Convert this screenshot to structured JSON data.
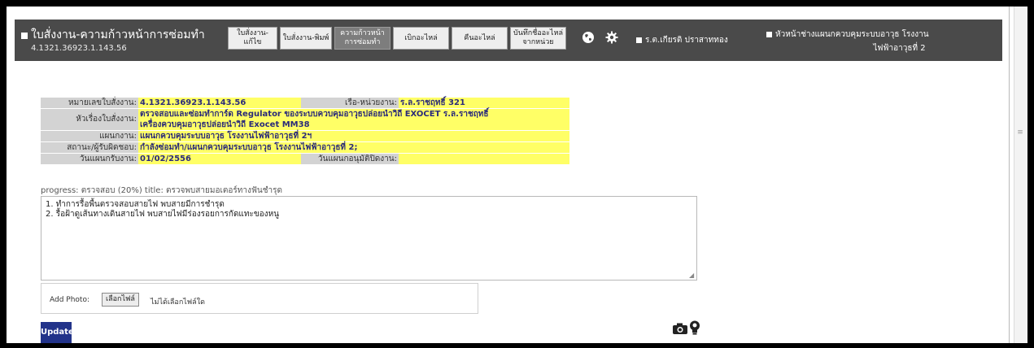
{
  "header": {
    "title": "ใบสั่งงาน-ความก้าวหน้าการซ่อมทำ",
    "subtitle": "4.1321.36923.1.143.56",
    "menu": [
      {
        "label": "ใบสั่งงาน-แก้ไข"
      },
      {
        "label": "ใบสั่งงาน-พิมพ์"
      },
      {
        "label": "ความก้าวหน้า การซ่อมทำ"
      },
      {
        "label": "เบิกอะไหล่"
      },
      {
        "label": "คืนอะไหล่"
      },
      {
        "label": "บันทึกชื่ออะไหล่ จากหน่วย"
      }
    ],
    "icons": [
      "globe-icon",
      "gear-icon"
    ],
    "links": [
      {
        "label": "ร.ต.เกียรติ ปราสาททอง"
      },
      {
        "label": "หัวหน้าช่างแผนกควบคุมระบบอาวุธ โรงงานไฟฟ้าอาวุธที่ 2"
      }
    ],
    "link2_line1": "หัวหน้าช่างแผนกควบคุมระบบอาวุธ โรงงาน",
    "link2_line2": "ไฟฟ้าอาวุธที่ 2"
  },
  "info": {
    "work_order_no_label": "หมายเลขใบสั่งงาน:",
    "work_order_no": "4.1321.36923.1.143.56",
    "ship_label": "เรือ-หน่วยงาน:",
    "ship": "ร.ล.ราชฤทธิ์ 321",
    "subject_label": "หัวเรื่องใบสั่งงาน:",
    "subject_line1": "ตรวจสอบและซ่อมทำการ์ด Regulator ของระบบควบคุมอาวุธปล่อยนำวิถี EXOCET ร.ล.ราชฤทธิ์",
    "subject_line2": "เครื่องควบคุมอาวุธปล่อยนำวิถี Exocet MM38",
    "dept_label": "แผนกงาน:",
    "dept": "แผนกควบคุมระบบอาวุธ โรงงานไฟฟ้าอาวุธที่ 2ฯ",
    "status_label": "สถานะ/ผู้รับผิดชอบ:",
    "status": "กำลังซ่อมทำ/แผนกควบคุมระบบอาวุธ โรงงานไฟฟ้าอาวุธที่ 2;",
    "received_date_label": "วันแผนกรับงาน:",
    "received_date": "01/02/2556",
    "approve_date_label": "วันแผนกอนุมัติปิดงาน:",
    "approve_date": ""
  },
  "progress": {
    "text": "progress: ตรวจสอบ (20%) title: ตรวจพบสายมอเตอร์ทางฟันชำรุด",
    "percent": 20,
    "notes": "1. ทำการรื้อพื้นตรวจสอบสายไฟ พบสายมีการชำรุด\n2. รื้อฝ้าดูเส้นทางเดินสายไฟ พบสายไฟมีร่องรอยการกัดแทะของหนู"
  },
  "photo": {
    "label": "Add Photo:",
    "button": "เลือกไฟล์",
    "status": "ไม่ได้เลือกไฟล์ใด"
  },
  "update_label": "Update",
  "colors": {
    "header_bg": "#4a4a4a",
    "label_bg": "#d3d3d3",
    "value_bg": "#ffff66",
    "update_bg": "#22338a"
  }
}
